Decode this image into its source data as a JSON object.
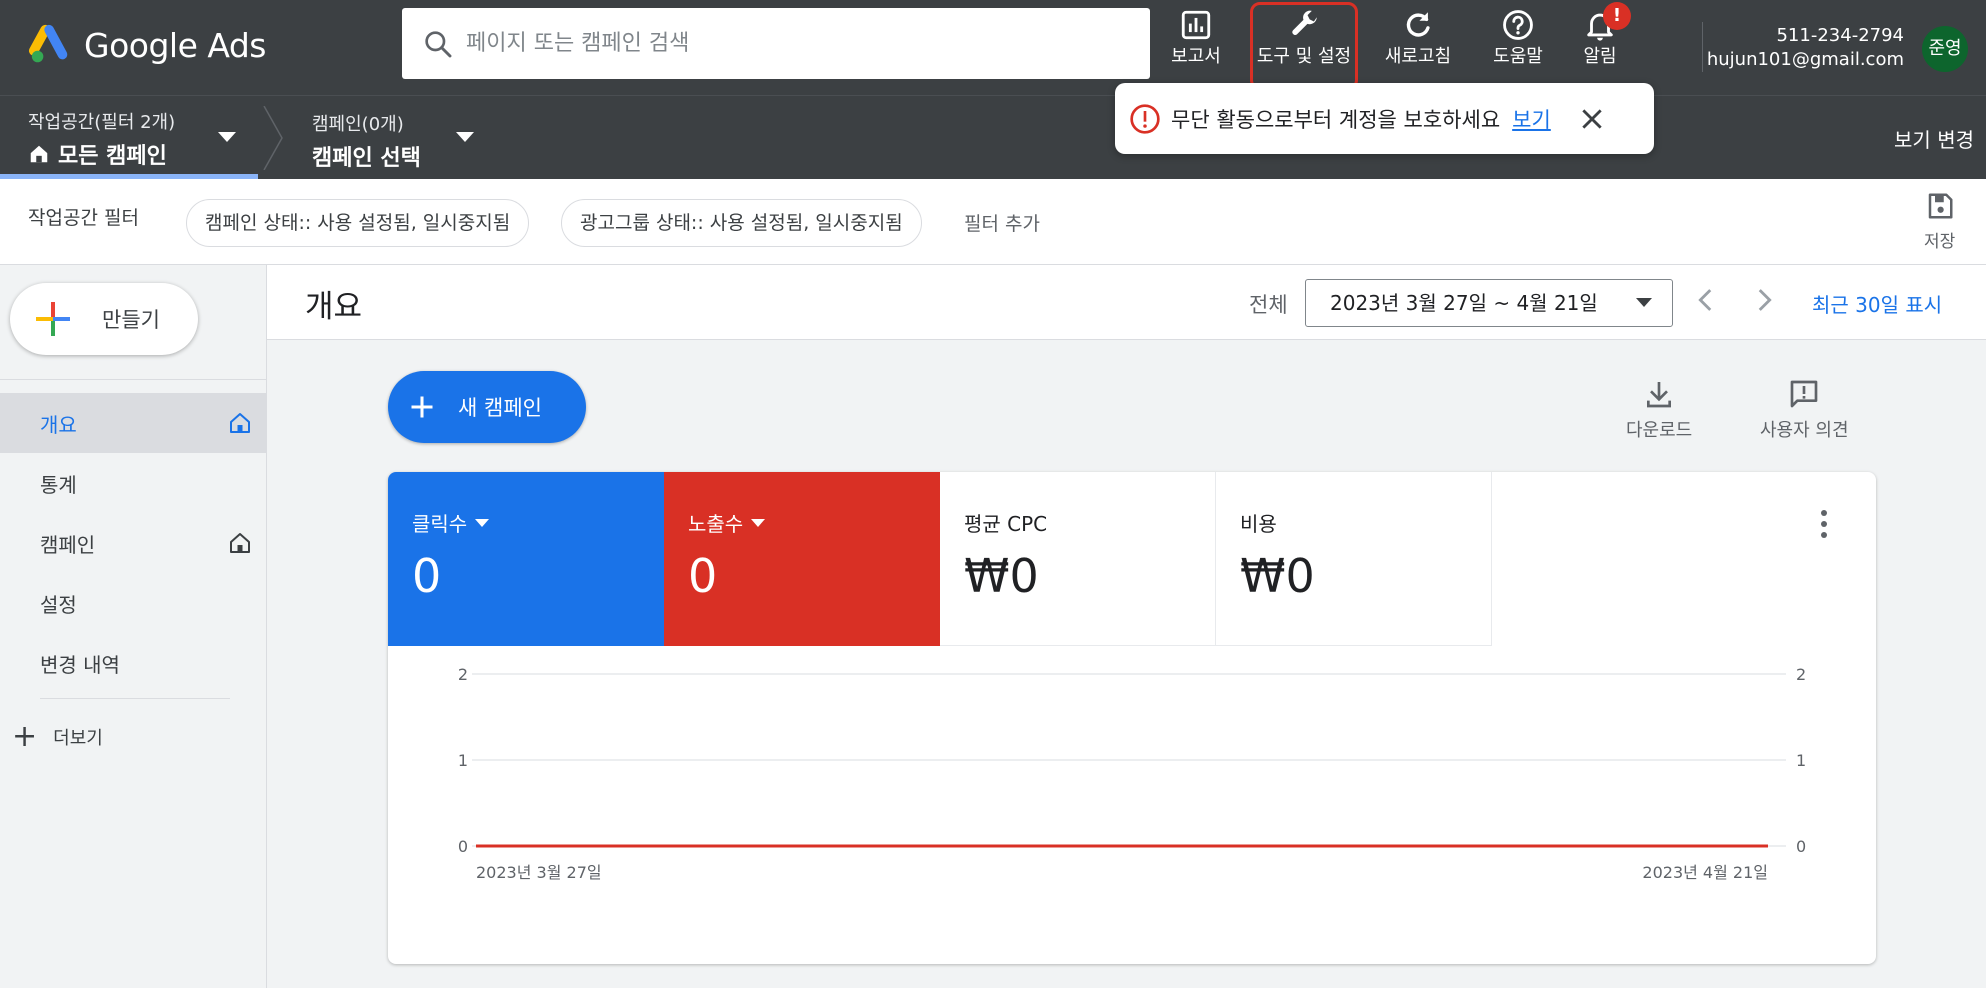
{
  "header": {
    "logo_text": "Google Ads",
    "search_placeholder": "페이지 또는 캠페인 검색",
    "buttons": [
      {
        "label": "보고서",
        "icon": "bar-chart-icon"
      },
      {
        "label": "도구 및 설정",
        "icon": "wrench-icon"
      },
      {
        "label": "새로고침",
        "icon": "refresh-icon"
      },
      {
        "label": "도움말",
        "icon": "help-icon"
      },
      {
        "label": "알림",
        "icon": "bell-icon"
      }
    ],
    "notification_badge": "!",
    "account_phone": "511-234-2794",
    "account_email": "hujun101@gmail.com",
    "avatar_text": "준영"
  },
  "workspace": {
    "label": "작업공간(필터 2개)",
    "value": "모든 캠페인",
    "campaign_label": "캠페인(0개)",
    "campaign_value": "캠페인 선택",
    "view_change": "보기 변경"
  },
  "alert": {
    "text": "무단 활동으로부터 계정을 보호하세요",
    "link": "보기"
  },
  "filters": {
    "label": "작업공간 필터",
    "chips": [
      "캠페인 상태:: 사용 설정됨, 일시중지됨",
      "광고그룹 상태:: 사용 설정됨, 일시중지됨"
    ],
    "add": "필터 추가",
    "save": "저장"
  },
  "sidebar": {
    "create": "만들기",
    "items": [
      {
        "label": "개요",
        "active": true
      },
      {
        "label": "통계"
      },
      {
        "label": "캠페인"
      },
      {
        "label": "설정"
      },
      {
        "label": "변경 내역"
      }
    ],
    "more": "더보기"
  },
  "main": {
    "title": "개요",
    "range_label": "전체",
    "date_range": "2023년 3월 27일 ~ 4월 21일",
    "recent": "최근 30일 표시",
    "new_campaign": "새 캠페인",
    "download": "다운로드",
    "feedback": "사용자 의견",
    "metrics": [
      {
        "label": "클릭수",
        "value": "0",
        "color": "#1a73e8"
      },
      {
        "label": "노출수",
        "value": "0",
        "color": "#d93025"
      },
      {
        "label": "평균 CPC",
        "value": "₩0"
      },
      {
        "label": "비용",
        "value": "₩0"
      }
    ]
  },
  "chart_data": {
    "type": "line",
    "x": [
      "2023년 3월 27일",
      "2023년 4월 21일"
    ],
    "series": [
      {
        "name": "클릭수",
        "values": [
          0,
          0
        ],
        "color": "#1a73e8"
      },
      {
        "name": "노출수",
        "values": [
          0,
          0
        ],
        "color": "#d93025"
      }
    ],
    "ylim": [
      0,
      2
    ],
    "yticks": [
      "0",
      "1",
      "2"
    ],
    "y2ticks": [
      "0",
      "1",
      "2"
    ],
    "xlabels": [
      "2023년 3월 27일",
      "2023년 4월 21일"
    ]
  }
}
